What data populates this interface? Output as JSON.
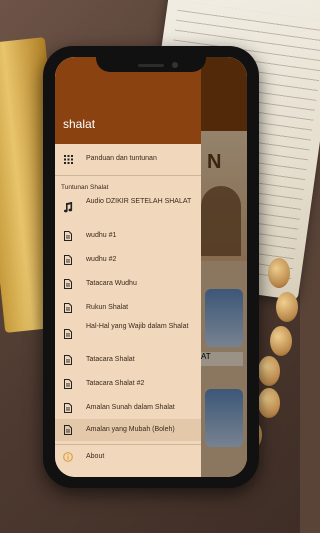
{
  "app": {
    "title": "shalat"
  },
  "drawer": {
    "top_item": {
      "label": "Panduan dan tuntunan",
      "icon": "grid-icon"
    },
    "section_title": "Tuntunan Shalat",
    "items": [
      {
        "label": "Audio DZIKIR SETELAH SHALAT",
        "icon": "music-note-icon"
      },
      {
        "label": "wudhu #1",
        "icon": "document-icon"
      },
      {
        "label": "wudhu #2",
        "icon": "document-icon"
      },
      {
        "label": "Tatacara Wudhu",
        "icon": "document-icon"
      },
      {
        "label": "Rukun Shalat",
        "icon": "document-icon"
      },
      {
        "label": "Hal-Hal yang Wajib dalam Shalat",
        "icon": "document-icon"
      },
      {
        "label": "Tatacara Shalat",
        "icon": "document-icon"
      },
      {
        "label": "Tatacara Shalat #2",
        "icon": "document-icon"
      },
      {
        "label": "Amalan Sunah dalam Shalat",
        "icon": "document-icon"
      },
      {
        "label": "Amalan yang Mubah (Boleh)",
        "icon": "document-icon"
      }
    ],
    "bottom_item": {
      "label": "About",
      "icon": "info-icon"
    }
  },
  "background": {
    "banner_letter": "N",
    "card_label": "AT"
  },
  "colors": {
    "header": "#8a4210",
    "drawer_bg": "#f1d7bb",
    "accent_icon": "#e0a340"
  }
}
